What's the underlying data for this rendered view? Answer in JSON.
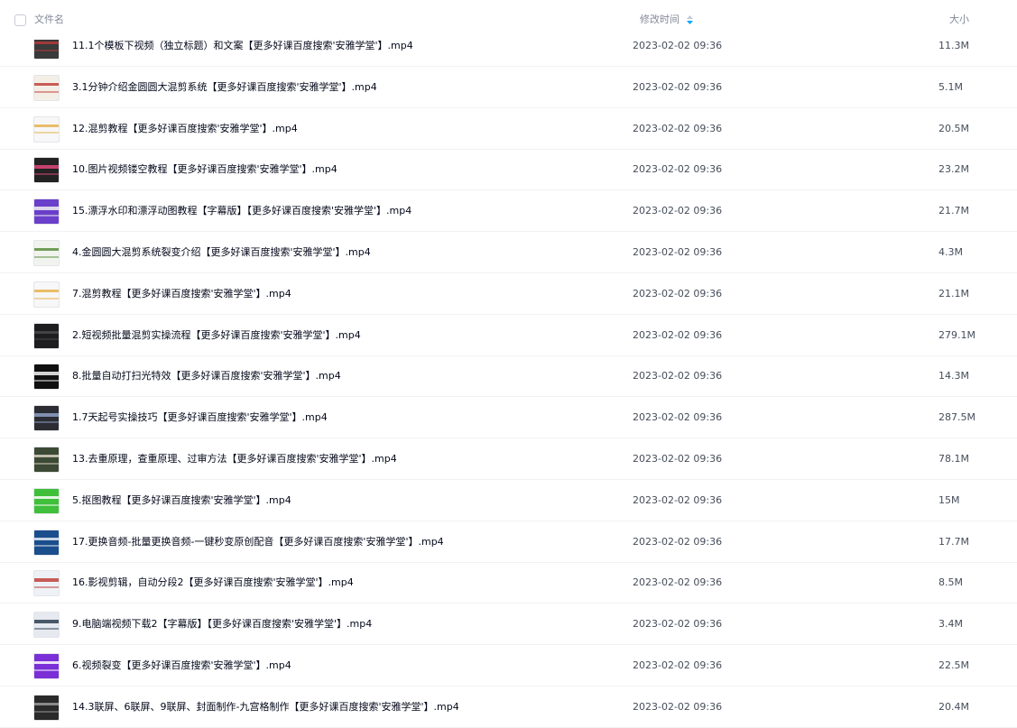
{
  "header": {
    "name_label": "文件名",
    "time_label": "修改时间",
    "size_label": "大小",
    "sort_color": "#06a7ff"
  },
  "files": [
    {
      "name": "11.1个模板下视频（独立标题）和文案【更多好课百度搜索'安雅学堂'】.mp4",
      "time": "2023-02-02 09:36",
      "size": "11.3M",
      "thumb": {
        "bg": "#3a3a3a",
        "accent": "#b33a3a"
      }
    },
    {
      "name": "3.1分钟介绍金圆圆大混剪系统【更多好课百度搜索'安雅学堂'】.mp4",
      "time": "2023-02-02 09:36",
      "size": "5.1M",
      "thumb": {
        "bg": "#f4efe6",
        "accent": "#c0413b"
      }
    },
    {
      "name": "12.混剪教程【更多好课百度搜索'安雅学堂'】.mp4",
      "time": "2023-02-02 09:36",
      "size": "20.5M",
      "thumb": {
        "bg": "#f7f7f7",
        "accent": "#e6b450"
      }
    },
    {
      "name": "10.图片视频镂空教程【更多好课百度搜索'安雅学堂'】.mp4",
      "time": "2023-02-02 09:36",
      "size": "23.2M",
      "thumb": {
        "bg": "#222222",
        "accent": "#e0487a"
      }
    },
    {
      "name": "15.漂浮水印和漂浮动图教程【字幕版】【更多好课百度搜索'安雅学堂'】.mp4",
      "time": "2023-02-02 09:36",
      "size": "21.7M",
      "thumb": {
        "bg": "#6a3fc9",
        "accent": "#f2f2f2"
      }
    },
    {
      "name": "4.金圆圆大混剪系统裂变介绍【更多好课百度搜索'安雅学堂'】.mp4",
      "time": "2023-02-02 09:36",
      "size": "4.3M",
      "thumb": {
        "bg": "#f1f4ee",
        "accent": "#5b8d3e"
      }
    },
    {
      "name": "7.混剪教程【更多好课百度搜索'安雅学堂'】.mp4",
      "time": "2023-02-02 09:36",
      "size": "21.1M",
      "thumb": {
        "bg": "#f7f7f7",
        "accent": "#e6b450"
      }
    },
    {
      "name": "2.短视频批量混剪实操流程【更多好课百度搜索'安雅学堂'】.mp4",
      "time": "2023-02-02 09:36",
      "size": "279.1M",
      "thumb": {
        "bg": "#1d1d1f",
        "accent": "#4a4a4a"
      }
    },
    {
      "name": "8.批量自动打扫光特效【更多好课百度搜索'安雅学堂'】.mp4",
      "time": "2023-02-02 09:36",
      "size": "14.3M",
      "thumb": {
        "bg": "#101010",
        "accent": "#f5f5f5"
      }
    },
    {
      "name": "1.7天起号实操技巧【更多好课百度搜索'安雅学堂'】.mp4",
      "time": "2023-02-02 09:36",
      "size": "287.5M",
      "thumb": {
        "bg": "#2b2d33",
        "accent": "#8fa1c7"
      }
    },
    {
      "name": "13.去重原理，查重原理、过审方法【更多好课百度搜索'安雅学堂'】.mp4",
      "time": "2023-02-02 09:36",
      "size": "78.1M",
      "thumb": {
        "bg": "#3c4a35",
        "accent": "#d9d2c0"
      }
    },
    {
      "name": "5.抠图教程【更多好课百度搜索'安雅学堂'】.mp4",
      "time": "2023-02-02 09:36",
      "size": "15M",
      "thumb": {
        "bg": "#3fbf3a",
        "accent": "#ffffff"
      }
    },
    {
      "name": "17.更换音频-批量更换音频-一键秒变原创配音【更多好课百度搜索'安雅学堂'】.mp4",
      "time": "2023-02-02 09:36",
      "size": "17.7M",
      "thumb": {
        "bg": "#1b4e8c",
        "accent": "#e8eef6"
      }
    },
    {
      "name": "16.影视剪辑，自动分段2【更多好课百度搜索'安雅学堂'】.mp4",
      "time": "2023-02-02 09:36",
      "size": "8.5M",
      "thumb": {
        "bg": "#eef1f5",
        "accent": "#c0413b"
      }
    },
    {
      "name": "9.电脑端视频下载2【字幕版】【更多好课百度搜索'安雅学堂'】.mp4",
      "time": "2023-02-02 09:36",
      "size": "3.4M",
      "thumb": {
        "bg": "#e6eaf0",
        "accent": "#2c3e50"
      }
    },
    {
      "name": "6.视频裂变【更多好课百度搜索'安雅学堂'】.mp4",
      "time": "2023-02-02 09:36",
      "size": "22.5M",
      "thumb": {
        "bg": "#7b2fd6",
        "accent": "#ffffff"
      }
    },
    {
      "name": "14.3联屏、6联屏、9联屏、封面制作-九宫格制作【更多好课百度搜索'安雅学堂'】.mp4",
      "time": "2023-02-02 09:36",
      "size": "20.4M",
      "thumb": {
        "bg": "#2a2a2a",
        "accent": "#9a9a9a"
      }
    }
  ]
}
